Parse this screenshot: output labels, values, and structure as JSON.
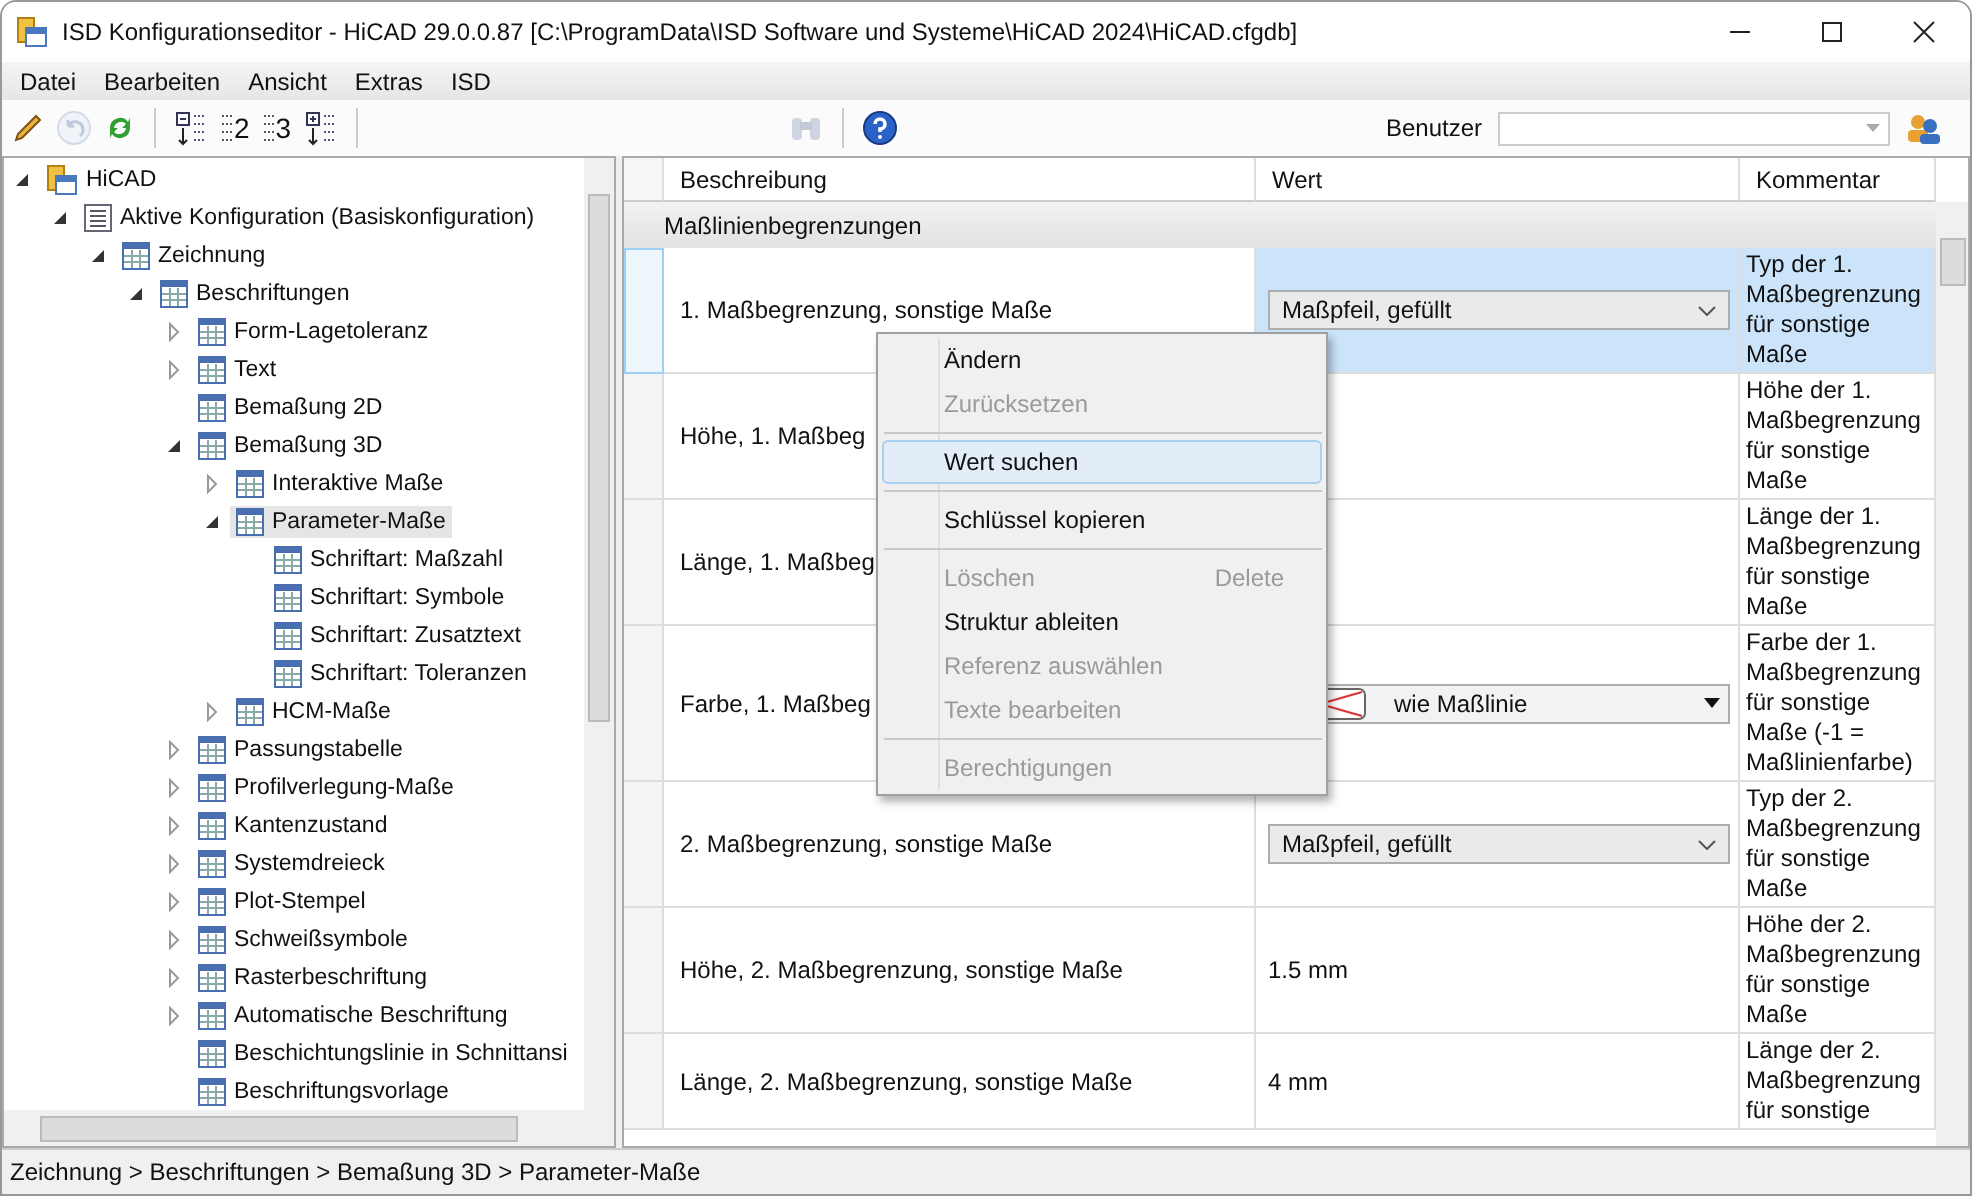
{
  "window": {
    "title": "ISD Konfigurationseditor  - HiCAD 29.0.0.87 [C:\\ProgramData\\ISD Software und Systeme\\HiCAD 2024\\HiCAD.cfgdb]"
  },
  "menu": [
    "Datei",
    "Bearbeiten",
    "Ansicht",
    "Extras",
    "ISD"
  ],
  "toolbar": [
    {
      "kind": "pencil",
      "disabled": false
    },
    {
      "kind": "undo",
      "disabled": true
    },
    {
      "kind": "refresh",
      "disabled": false
    },
    {
      "kind": "sep"
    },
    {
      "kind": "collapse",
      "disabled": false
    },
    {
      "kind": "level",
      "label": "2",
      "disabled": false
    },
    {
      "kind": "level",
      "label": "3",
      "disabled": false
    },
    {
      "kind": "expand",
      "disabled": false
    },
    {
      "kind": "sep"
    },
    {
      "kind": "spacer"
    },
    {
      "kind": "find",
      "disabled": true
    },
    {
      "kind": "sep"
    },
    {
      "kind": "help",
      "disabled": false
    }
  ],
  "user": {
    "label": "Benutzer"
  },
  "tree": [
    {
      "label": "HiCAD",
      "kind": "root",
      "expanded": true,
      "selected": false,
      "children": [
        {
          "label": "Aktive Konfiguration (Basiskonfiguration)",
          "kind": "config",
          "expanded": true,
          "selected": false,
          "children": [
            {
              "label": "Zeichnung",
              "kind": "table",
              "expanded": true,
              "selected": false,
              "children": [
                {
                  "label": "Beschriftungen",
                  "kind": "table",
                  "expanded": true,
                  "selected": false,
                  "children": [
                    {
                      "label": "Form-Lagetoleranz",
                      "kind": "table",
                      "expanded": false,
                      "selected": false
                    },
                    {
                      "label": "Text",
                      "kind": "table",
                      "expanded": false,
                      "selected": false
                    },
                    {
                      "label": "Bemaßung 2D",
                      "kind": "table",
                      "selected": false
                    },
                    {
                      "label": "Bemaßung 3D",
                      "kind": "table",
                      "expanded": true,
                      "selected": false,
                      "children": [
                        {
                          "label": "Interaktive Maße",
                          "kind": "table",
                          "expanded": false,
                          "selected": false
                        },
                        {
                          "label": "Parameter-Maße",
                          "kind": "table",
                          "expanded": true,
                          "selected": true,
                          "children": [
                            {
                              "label": "Schriftart: Maßzahl",
                              "kind": "table",
                              "selected": false
                            },
                            {
                              "label": "Schriftart: Symbole",
                              "kind": "table",
                              "selected": false
                            },
                            {
                              "label": "Schriftart: Zusatztext",
                              "kind": "table",
                              "selected": false
                            },
                            {
                              "label": "Schriftart: Toleranzen",
                              "kind": "table",
                              "selected": false
                            }
                          ]
                        },
                        {
                          "label": "HCM-Maße",
                          "kind": "table",
                          "expanded": false,
                          "selected": false
                        }
                      ]
                    },
                    {
                      "label": "Passungstabelle",
                      "kind": "table",
                      "expanded": false,
                      "selected": false
                    },
                    {
                      "label": "Profilverlegung-Maße",
                      "kind": "table",
                      "expanded": false,
                      "selected": false
                    },
                    {
                      "label": "Kantenzustand",
                      "kind": "table",
                      "expanded": false,
                      "selected": false
                    },
                    {
                      "label": "Systemdreieck",
                      "kind": "table",
                      "expanded": false,
                      "selected": false
                    },
                    {
                      "label": "Plot-Stempel",
                      "kind": "table",
                      "expanded": false,
                      "selected": false
                    },
                    {
                      "label": "Schweißsymbole",
                      "kind": "table",
                      "expanded": false,
                      "selected": false
                    },
                    {
                      "label": "Rasterbeschriftung",
                      "kind": "table",
                      "expanded": false,
                      "selected": false
                    },
                    {
                      "label": "Automatische Beschriftung",
                      "kind": "table",
                      "expanded": false,
                      "selected": false
                    },
                    {
                      "label": "Beschichtungslinie in Schnittansi",
                      "kind": "table",
                      "selected": false
                    },
                    {
                      "label": "Beschriftungsvorlage",
                      "kind": "table",
                      "selected": false
                    }
                  ]
                }
              ]
            }
          ]
        }
      ]
    }
  ],
  "grid": {
    "columns": [
      "Beschreibung",
      "Wert",
      "Kommentar"
    ],
    "group": "Maßlinienbegrenzungen",
    "rows": [
      {
        "description": "1. Maßbegrenzung, sonstige Maße",
        "kind": "dropdown",
        "value": "Maßpfeil, gefüllt",
        "comment": "Typ der 1. Maßbegrenzung für sonstige Maße",
        "selected": true
      },
      {
        "description": "Höhe, 1. Maßbeg",
        "kind": "none",
        "comment": "Höhe der 1. Maßbegrenzung für sonstige Maße",
        "selected": false
      },
      {
        "description": "Länge, 1. Maßbeg",
        "kind": "none",
        "comment": "Länge der 1. Maßbegrenzung für sonstige Maße",
        "selected": false
      },
      {
        "description": "Farbe, 1. Maßbeg",
        "kind": "color",
        "value": "wie Maßlinie",
        "comment": "Farbe der 1. Maßbegrenzung für sonstige Maße (-1 = Maßlinienfarbe)",
        "selected": false
      },
      {
        "description": "2. Maßbegrenzung, sonstige Maße",
        "kind": "dropdown",
        "value": "Maßpfeil, gefüllt",
        "comment": "Typ der 2. Maßbegrenzung für sonstige Maße",
        "selected": false
      },
      {
        "description": "Höhe, 2. Maßbegrenzung, sonstige Maße",
        "kind": "text",
        "value": "1.5 mm",
        "comment": "Höhe der 2. Maßbegrenzung für sonstige Maße",
        "selected": false
      },
      {
        "description": "Länge, 2. Maßbegrenzung, sonstige Maße",
        "kind": "text",
        "value": "4 mm",
        "comment": "Länge der 2. Maßbegrenzung für sonstige",
        "selected": false
      }
    ]
  },
  "context_menu": [
    {
      "kind": "item",
      "label": "Ändern",
      "disabled": false,
      "selected": false
    },
    {
      "kind": "item",
      "label": "Zurücksetzen",
      "disabled": true,
      "selected": false
    },
    {
      "kind": "separator"
    },
    {
      "kind": "item",
      "label": "Wert suchen",
      "disabled": false,
      "selected": true
    },
    {
      "kind": "separator"
    },
    {
      "kind": "item",
      "label": "Schlüssel kopieren",
      "disabled": false,
      "selected": false
    },
    {
      "kind": "separator"
    },
    {
      "kind": "item",
      "label": "Löschen",
      "shortcut": "Delete",
      "disabled": true,
      "selected": false
    },
    {
      "kind": "item",
      "label": "Struktur ableiten",
      "disabled": false,
      "selected": false
    },
    {
      "kind": "item",
      "label": "Referenz auswählen",
      "disabled": true,
      "selected": false
    },
    {
      "kind": "item",
      "label": "Texte bearbeiten",
      "disabled": true,
      "selected": false
    },
    {
      "kind": "separator"
    },
    {
      "kind": "item",
      "label": "Berechtigungen",
      "disabled": true,
      "selected": false
    }
  ],
  "status_bar": "Zeichnung > Beschriftungen > Bemaßung 3D > Parameter-Maße"
}
